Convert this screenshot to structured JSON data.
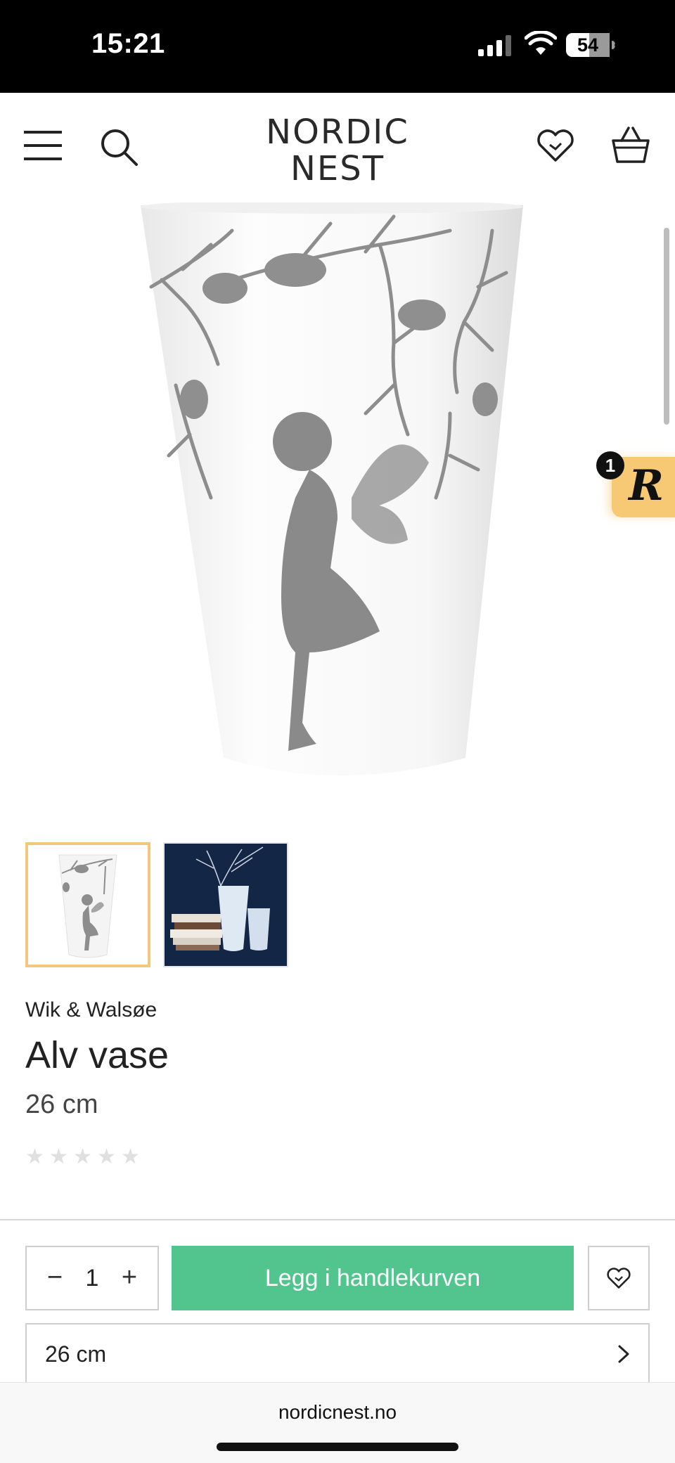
{
  "status_bar": {
    "time": "15:21",
    "battery": "54"
  },
  "header": {
    "logo_line1": "NORDIC",
    "logo_line2": "NEST"
  },
  "badge": {
    "count": "1",
    "letter": "R",
    "color": "#f7c974"
  },
  "product": {
    "brand": "Wik & Walsøe",
    "title": "Alv vase",
    "variant": "26 cm",
    "rating": 0,
    "rating_max": 5
  },
  "purchase": {
    "minus": "−",
    "quantity": "1",
    "plus": "+",
    "add_to_cart": "Legg i handlekurven",
    "accent": "#52c58f"
  },
  "size_select": {
    "value": "26 cm"
  },
  "browser": {
    "url": "nordicnest.no"
  }
}
